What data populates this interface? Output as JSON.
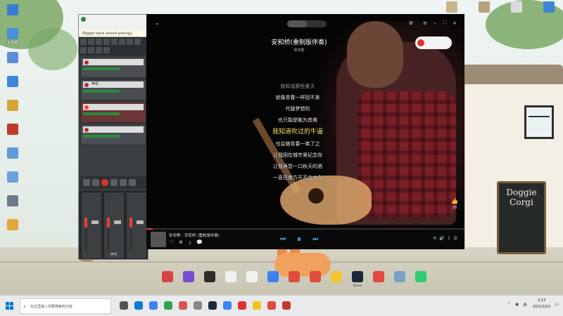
{
  "desktop": {
    "icons_left": [
      {
        "label": "",
        "color": "#3a7bd5"
      },
      {
        "label": "此电脑",
        "color": "#4a8fd8"
      },
      {
        "label": "",
        "color": "#5b8ed6"
      },
      {
        "label": "",
        "color": "#3f86d4"
      },
      {
        "label": "",
        "color": "#d9a43a"
      },
      {
        "label": "",
        "color": "#c0392b"
      },
      {
        "label": "",
        "color": "#5f9ad9"
      },
      {
        "label": "",
        "color": "#6aa0dd"
      },
      {
        "label": "",
        "color": "#6b7b8c"
      },
      {
        "label": "",
        "color": "#e0a93a"
      }
    ],
    "icons_top_right": [
      {
        "label": "",
        "color": "#c9b48d"
      },
      {
        "label": "",
        "color": "#b8a27a"
      },
      {
        "label": "",
        "color": "#dcdcdc"
      },
      {
        "label": "",
        "color": "#3f86d4"
      },
      {
        "label": "",
        "color": "#5b8ed6"
      }
    ],
    "shelf_apps": [
      {
        "label": "",
        "color": "#d64545"
      },
      {
        "label": "",
        "color": "#7a4bd1"
      },
      {
        "label": "",
        "color": "#2d2d2d"
      },
      {
        "label": "",
        "color": "#f0f0f0"
      },
      {
        "label": "",
        "color": "#f2f2f2"
      },
      {
        "label": "",
        "color": "#3b82f6"
      },
      {
        "label": "",
        "color": "#e04a3f"
      },
      {
        "label": "",
        "color": "#e04a3f"
      },
      {
        "label": "",
        "color": "#f4c430"
      },
      {
        "label": "Steam",
        "color": "#1b2838"
      },
      {
        "label": "",
        "color": "#e04a3f"
      },
      {
        "label": "",
        "color": "#7aa0c8"
      },
      {
        "label": "",
        "color": "#2ecc71"
      }
    ],
    "chalkboard": {
      "line1": "",
      "title": "Doggie Corgi",
      "line3": ""
    },
    "window_sign": ""
  },
  "reaper": {
    "title": "",
    "menu": "",
    "tooltip": "[Toggle track record arming]",
    "tracks": [
      {
        "name": "",
        "db": "",
        "armed": false
      },
      {
        "name": "声乐",
        "db": "",
        "armed": false
      },
      {
        "name": "",
        "db": "",
        "armed": true
      },
      {
        "name": "",
        "db": "",
        "armed": false
      }
    ],
    "mixer_strips": [
      {
        "name": ""
      },
      {
        "name": "声乐"
      },
      {
        "name": ""
      }
    ]
  },
  "player": {
    "tabs": [
      "",
      ""
    ],
    "active_tab": 0,
    "song_title": "安和桥(重制版伴奏)",
    "artist": "宋冬野",
    "popup": "",
    "header_text": "",
    "lyrics": [
      {
        "text": "我知道那些夏天",
        "state": "dim"
      },
      {
        "text": "就像青春一样回不来",
        "state": "normal"
      },
      {
        "text": "代替梦想的",
        "state": "normal"
      },
      {
        "text": "也只能是勉为其难",
        "state": "normal"
      },
      {
        "text": "我知道吹过的牛逼",
        "state": "current"
      },
      {
        "text": "也会随青春一笑了之",
        "state": "normal"
      },
      {
        "text": "让我困在城市里纪念你",
        "state": "normal"
      },
      {
        "text": "让我再尝一口秋天的酒",
        "state": "normal"
      },
      {
        "text": "一直往南方开不会太久",
        "state": "normal"
      }
    ],
    "comment": "",
    "likes": "28",
    "progress_fraction": 0.02,
    "now_playing": "宋冬野 - 安和桥 (重制版伴奏)",
    "time": "",
    "accent": "#5db3ff"
  },
  "taskbar": {
    "search_placeholder": "在这里输入你要搜索的内容",
    "time": "3:13",
    "date": "2021/10/2",
    "pinned_colors": [
      "#555",
      "#0f7ad6",
      "#3b82f6",
      "#2ea44f",
      "#d9534f",
      "#888",
      "#1b2838",
      "#3b82f6",
      "#d33",
      "#f0c419",
      "#e04a3f",
      "#c0392b"
    ]
  }
}
